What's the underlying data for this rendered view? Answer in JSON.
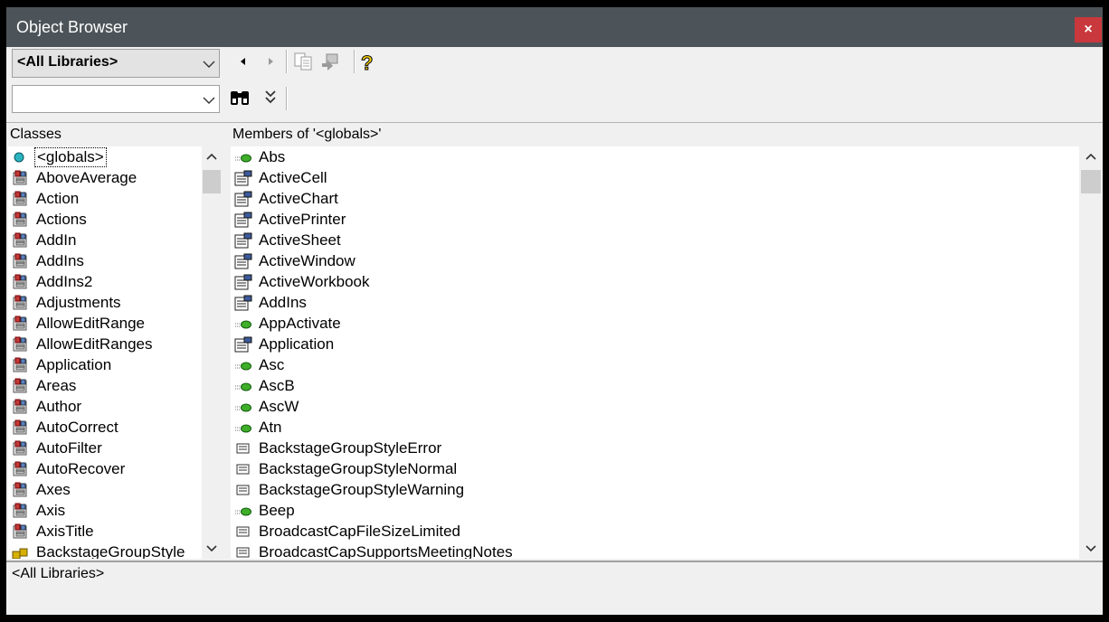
{
  "window": {
    "title": "Object Browser",
    "close_label": "×"
  },
  "toolbar": {
    "library_value": "<All Libraries>",
    "search_value": "",
    "icons": [
      "back-icon",
      "forward-icon",
      "copy-icon",
      "view-definition-icon",
      "help-icon",
      "search-icon",
      "expand-icon"
    ]
  },
  "classes": {
    "header": "Classes",
    "items": [
      {
        "label": "<globals>",
        "icon": "globals-icon",
        "selected": true
      },
      {
        "label": "AboveAverage",
        "icon": "class-icon"
      },
      {
        "label": "Action",
        "icon": "class-icon"
      },
      {
        "label": "Actions",
        "icon": "class-icon"
      },
      {
        "label": "AddIn",
        "icon": "class-icon"
      },
      {
        "label": "AddIns",
        "icon": "class-icon"
      },
      {
        "label": "AddIns2",
        "icon": "class-icon"
      },
      {
        "label": "Adjustments",
        "icon": "class-icon"
      },
      {
        "label": "AllowEditRange",
        "icon": "class-icon"
      },
      {
        "label": "AllowEditRanges",
        "icon": "class-icon"
      },
      {
        "label": "Application",
        "icon": "class-icon"
      },
      {
        "label": "Areas",
        "icon": "class-icon"
      },
      {
        "label": "Author",
        "icon": "class-icon"
      },
      {
        "label": "AutoCorrect",
        "icon": "class-icon"
      },
      {
        "label": "AutoFilter",
        "icon": "class-icon"
      },
      {
        "label": "AutoRecover",
        "icon": "class-icon"
      },
      {
        "label": "Axes",
        "icon": "class-icon"
      },
      {
        "label": "Axis",
        "icon": "class-icon"
      },
      {
        "label": "AxisTitle",
        "icon": "class-icon"
      },
      {
        "label": "BackstageGroupStyle",
        "icon": "enum-icon"
      }
    ]
  },
  "members": {
    "header": "Members of '<globals>'",
    "items": [
      {
        "label": "Abs",
        "icon": "method-icon"
      },
      {
        "label": "ActiveCell",
        "icon": "property-icon"
      },
      {
        "label": "ActiveChart",
        "icon": "property-icon"
      },
      {
        "label": "ActivePrinter",
        "icon": "property-icon"
      },
      {
        "label": "ActiveSheet",
        "icon": "property-icon"
      },
      {
        "label": "ActiveWindow",
        "icon": "property-icon"
      },
      {
        "label": "ActiveWorkbook",
        "icon": "property-icon"
      },
      {
        "label": "AddIns",
        "icon": "property-icon"
      },
      {
        "label": "AppActivate",
        "icon": "method-icon"
      },
      {
        "label": "Application",
        "icon": "property-icon"
      },
      {
        "label": "Asc",
        "icon": "method-icon"
      },
      {
        "label": "AscB",
        "icon": "method-icon"
      },
      {
        "label": "AscW",
        "icon": "method-icon"
      },
      {
        "label": "Atn",
        "icon": "method-icon"
      },
      {
        "label": "BackstageGroupStyleError",
        "icon": "constant-icon"
      },
      {
        "label": "BackstageGroupStyleNormal",
        "icon": "constant-icon"
      },
      {
        "label": "BackstageGroupStyleWarning",
        "icon": "constant-icon"
      },
      {
        "label": "Beep",
        "icon": "method-icon"
      },
      {
        "label": "BroadcastCapFileSizeLimited",
        "icon": "constant-icon"
      },
      {
        "label": "BroadcastCapSupportsMeetingNotes",
        "icon": "constant-icon"
      }
    ]
  },
  "status": {
    "text": "<All Libraries>"
  },
  "colors": {
    "titlebar": "#4d5459",
    "close": "#c9383c",
    "background": "#f0f0f0"
  }
}
